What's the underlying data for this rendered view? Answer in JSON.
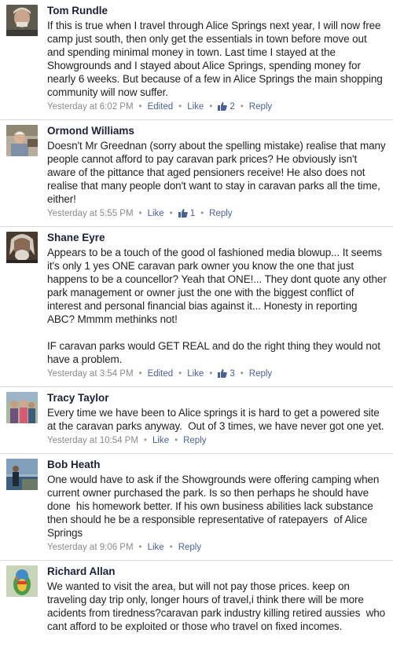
{
  "comments": [
    {
      "name": "Tom Rundle",
      "text": "If this is true when I travel through Alice Springs next year, I will now free camp just south, then only get the essentials in town before move out and spending minimal money in town. Last time I stayed at the Showgrounds and I stayed about Alice Springs, spending money for nearly 6 weeks. But because of a few in Alice Springs the main shopping community will now suffer.",
      "time": "Yesterday at 6:02 PM",
      "edited": "Edited",
      "like": "Like",
      "like_count": "2",
      "reply": "Reply"
    },
    {
      "name": "Ormond Williams",
      "text": "Doesn't Mr Greednan (sorry about the spelling mistake) realise that many people cannot afford to pay caravan park prices? He obviously isn't aware of the pittance that aged pensioners receive! He also does not realise that many people don't want to stay in caravan parks all the time, either!",
      "time": "Yesterday at 5:55 PM",
      "like": "Like",
      "like_count": "1",
      "reply": "Reply"
    },
    {
      "name": "Shane Eyre",
      "text": "Appears to be a touch of the good ol fashioned media blowup... It seems it's only 1 yes ONE caravan park owner you know the one that just happens to be a councellor? Yeah that ONE!... They dont quote any other park management or owner just the one with the biggest conflict of interest and personal financial bias against it... Honesty in reporting ABC? Mmmm methinks not!\n\nIF caravan parks would GET REAL and do the right thing they would not have a problem.",
      "time": "Yesterday at 3:54 PM",
      "edited": "Edited",
      "like": "Like",
      "like_count": "3",
      "reply": "Reply"
    },
    {
      "name": "Tracy Taylor",
      "text": "Every time we have been to Alice springs it is hard to get a powered site at the caravan parks anyway.  Out of 3 times, we have never got one yet.",
      "time": "Yesterday at 10:54 PM",
      "like": "Like",
      "reply": "Reply"
    },
    {
      "name": "Bob Heath",
      "text": "One would have to ask if the Showgrounds were offering camping when current owner purchased the park. Is so then perhaps he should have done  his homework better. If his own business abilities lack substance then should he be a responsible representative of ratepayers  of Alice Springs",
      "time": "Yesterday at 9:06 PM",
      "like": "Like",
      "reply": "Reply"
    },
    {
      "name": "Richard Allan",
      "text": "We wanted to visit the area, but will not pay those prices. keep on traveling day trip only, longer hours of travel,i think there will be more acidents from tiredness?caravan park industry killing retired aussies  who cant afford to be exploited or those who travel on fixed incomes."
    }
  ],
  "colors": {
    "name": "#1b2138",
    "link": "#4a6197",
    "meta": "#8a8a8a",
    "divider": "#d9d9d9"
  },
  "icons": {
    "like_count": "thumbs-up-icon"
  }
}
